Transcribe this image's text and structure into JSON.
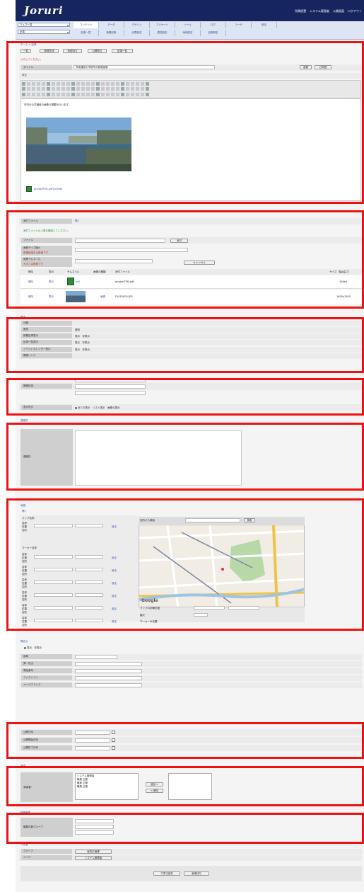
{
  "app": {
    "logo": "Joruri",
    "header_links": [
      "所属設置",
      "システム管理者",
      "公開画面",
      "ログアウト"
    ]
  },
  "nav": {
    "select1": "ウェブ一覧",
    "select2": "記事",
    "tabs_row1": [
      "コンテンツ",
      "データ",
      "デザイン",
      "アンケート",
      "ツール",
      "ログ",
      "ユーザ",
      "設定"
    ],
    "tabs_row2": [
      "記事一覧",
      "新着記事",
      "分野設定",
      "属性設定",
      "地域設定",
      "記事設定"
    ]
  },
  "breadcrumb": "ホーム > 記事",
  "toolbar_buttons": [
    "一覧",
    "新規作成",
    "承認待ち",
    "公開待ち",
    "記事一覧"
  ],
  "form_error": "入力してください。",
  "title_field": {
    "label": "タイトル",
    "value": "市政通信の市役所の新規画像",
    "size_label": "画像",
    "lang_label": "日本語"
  },
  "body_field": {
    "label": "本文",
    "text": "市内の公式通信の画像の掲載を行います。",
    "file_link": "photoHTML.pdf(100kb)"
  },
  "attachments": {
    "section_label": "添付ファイル",
    "open_link": "開く",
    "notice": "添付ファイルの上限を確認してください。",
    "file_label": "ファイル",
    "upload_button": "添付",
    "image_size_label": "画像サイズ縮小",
    "image_size_note": "縦横幅指定は数値です",
    "image_thumb_label": "画像サムネイル",
    "image_thumb_note": "大きさは数値です",
    "cancel_button": "キャンセル",
    "columns": [
      "削除",
      "表示",
      "サムネイル",
      "画像の種類",
      "添付ファイル",
      "サイズ（幅x高さ）"
    ],
    "rows": [
      {
        "del": "削除",
        "view": "表示",
        "thumb_type": "pdf",
        "type": "",
        "name": "photoHTML.pdf",
        "size": "100kb"
      },
      {
        "del": "削除",
        "view": "表示",
        "thumb_type": "photo",
        "type": "画像",
        "name": "P1010005.JPG",
        "size": "1600x1200"
      }
    ]
  },
  "settings": {
    "section_label": "基本",
    "rows": [
      {
        "label": "分類",
        "value": ""
      },
      {
        "label": "属性",
        "value": "選択"
      },
      {
        "label": "新着記事表示",
        "value": "表示　非表示"
      },
      {
        "label": "記事一覧表示",
        "value": "表示　非表示"
      },
      {
        "label": "イベントカレンダー表示",
        "value": "表示　非表示"
      },
      {
        "label": "関連リンク",
        "value": ""
      }
    ]
  },
  "related": {
    "label": "関連記事",
    "option": "表示する記事",
    "display_label": "表示形式",
    "display_value": "全ての表示　リスト表示　画像の表示"
  },
  "inquiry": {
    "section_label": "連絡先",
    "label": "連絡先"
  },
  "map": {
    "section_label": "地図",
    "open_link": "開く",
    "map_name_label": "マップ名称",
    "marker_label": "マーカー名称",
    "place_label": "名称",
    "lat_label": "位置",
    "address_label": "住所",
    "set_button": "設定",
    "search_label": "住所から検索",
    "search_button": "検索",
    "center_label": "マップの初期位置",
    "zoom_label": "縮尺",
    "marker_pos_label": "マーカーの位置",
    "google": "Google"
  },
  "contact": {
    "section_label": "問合せ",
    "radio": "表示　非表示",
    "rows": [
      "部局",
      "課・担当",
      "電話番号",
      "ファクシミリ",
      "メールアドレス"
    ]
  },
  "dates": {
    "rows": [
      "公開日時",
      "公開開始日時",
      "公開終了日時"
    ]
  },
  "approval": {
    "section_label": "承認",
    "label": "承認者",
    "add_button": "追加 >",
    "remove_button": "< 削除",
    "users": [
      "システム管理者",
      "職員 正範",
      "職員 正範",
      "職員 正範"
    ]
  },
  "editors": {
    "section_label": "編集権限",
    "label": "編集可能グループ"
  },
  "creator": {
    "section_label": "作成者",
    "group_label": "グループ",
    "group_value": "秘書広報課",
    "user_label": "ユーザ",
    "user_value": "システム管理者"
  },
  "submit": {
    "save": "下書き保存",
    "publish": "承認待ち"
  },
  "colors": {
    "header": "#16255e",
    "highlight": "#ee1111",
    "label_bg": "#cfcfcf",
    "link": "#2e55b0"
  }
}
